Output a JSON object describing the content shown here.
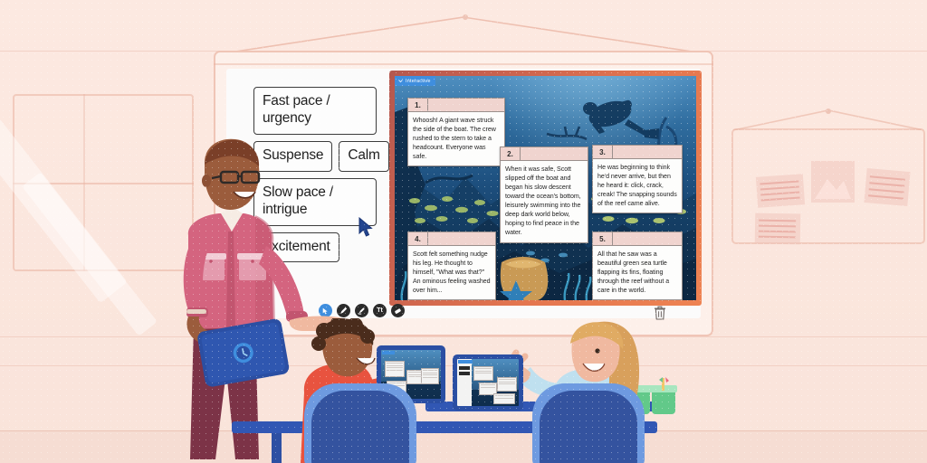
{
  "scene": {
    "setting": "classroom",
    "wall_color": "#fbe9e2",
    "floor_color": "#f6ddd3"
  },
  "whiteboard": {
    "label": "whiteboard",
    "chips": [
      {
        "id": "chip-fast-pace",
        "label": "Fast pace /\nurgency",
        "multiline": true
      },
      {
        "id": "chip-suspense",
        "label": "Suspense",
        "multiline": false
      },
      {
        "id": "chip-calm",
        "label": "Calm",
        "multiline": false
      },
      {
        "id": "chip-slow-pace",
        "label": "Slow pace /\nintrigue",
        "multiline": true
      },
      {
        "id": "chip-excitement",
        "label": "Excitement",
        "multiline": false
      }
    ],
    "cursor": "arrow-cursor"
  },
  "slide": {
    "badge_label": "Interactive",
    "badge_color": "#3f8ede",
    "frame_color": "#e4764f",
    "background_scene": "underwater coral reef with diver silhouette",
    "cards": [
      {
        "number": "1.",
        "text": "Whoosh! A giant wave struck the side of the boat. The crew rushed to the stern to take a headcount. Everyone was safe."
      },
      {
        "number": "2.",
        "text": "When it was safe, Scott slipped off the boat and began his slow descent toward the ocean's bottom, leisurely swimming into the deep dark world below, hoping to find peace in the water."
      },
      {
        "number": "3.",
        "text": "He was beginning to think he'd never arrive, but then he heard it: click, crack, creak! The snapping sounds of the reef came alive."
      },
      {
        "number": "4.",
        "text": "Scott felt something nudge his leg. He thought to himself, \"What was that?\" An ominous feeling washed over him..."
      },
      {
        "number": "5.",
        "text": "All that he saw was a beautiful green sea turtle flapping its fins, floating through the reef without a care in the world."
      }
    ]
  },
  "toolbar": {
    "tools": [
      {
        "id": "select-tool",
        "icon": "cursor-icon",
        "active": true
      },
      {
        "id": "pen-tool",
        "icon": "pen-icon",
        "active": false
      },
      {
        "id": "marker-tool",
        "icon": "marker-icon",
        "active": false
      },
      {
        "id": "text-tool",
        "icon": "text-icon",
        "label": "Tt",
        "active": false
      },
      {
        "id": "eraser-tool",
        "icon": "eraser-icon",
        "active": false
      }
    ],
    "delete_icon": "trash-icon"
  },
  "people": {
    "teacher": {
      "name": "teacher",
      "shirt_color": "#d4647f",
      "device": "tablet",
      "accessory": "glasses"
    },
    "student_left": {
      "name": "student-left",
      "shirt_color": "#e8533f",
      "device": "tablet",
      "chair_color": "#34539f"
    },
    "student_right": {
      "name": "student-right",
      "shirt_color": "#bfe0ef",
      "device": "tablet",
      "chair_color": "#34539f"
    }
  },
  "props": {
    "desk_color": "#3157b4",
    "bins_color": "#62c989",
    "pinboard": "pinned papers",
    "window": "classroom window"
  }
}
